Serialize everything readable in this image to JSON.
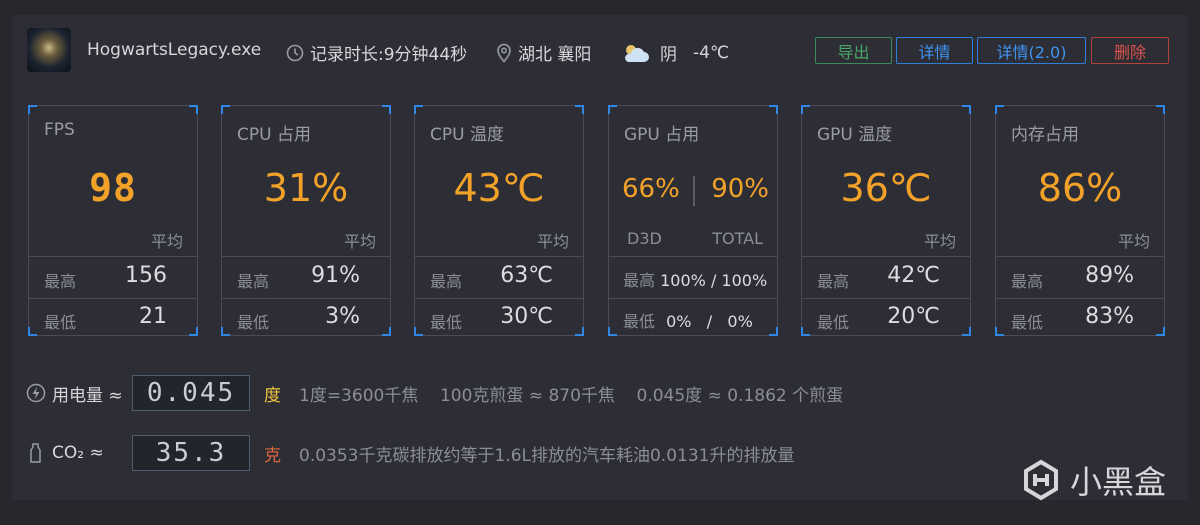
{
  "header": {
    "app_name": "HogwartsLegacy.exe",
    "record_duration": "记录时长:9分钟44秒",
    "location": "湖北 襄阳",
    "weather": "阴",
    "temperature": "-4℃",
    "buttons": {
      "export": "导出",
      "detail": "详情",
      "detail2": "详情(2.0)",
      "delete": "删除"
    }
  },
  "cards": {
    "fps": {
      "title": "FPS",
      "value": "98",
      "avg": "平均",
      "max_label": "最高",
      "max": "156",
      "min_label": "最低",
      "min": "21"
    },
    "cpu_usage": {
      "title": "CPU 占用",
      "value": "31%",
      "avg": "平均",
      "max_label": "最高",
      "max": "91%",
      "min_label": "最低",
      "min": "3%"
    },
    "cpu_temp": {
      "title": "CPU 温度",
      "value": "43℃",
      "avg": "平均",
      "max_label": "最高",
      "max": "63℃",
      "min_label": "最低",
      "min": "30℃"
    },
    "gpu_usage": {
      "title": "GPU 占用",
      "d3d": "66%",
      "total": "90%",
      "d3d_label": "D3D",
      "total_label": "TOTAL",
      "max_label": "最高",
      "max": "100% / 100%",
      "min_label": "最低",
      "min": "0%   /   0%"
    },
    "gpu_temp": {
      "title": "GPU 温度",
      "value": "36℃",
      "avg": "平均",
      "max_label": "最高",
      "max": "42℃",
      "min_label": "最低",
      "min": "20℃"
    },
    "memory": {
      "title": "内存占用",
      "value": "86%",
      "avg": "平均",
      "max_label": "最高",
      "max": "89%",
      "min_label": "最低",
      "min": "83%"
    }
  },
  "power": {
    "label": "用电量 ≈",
    "value": "0.045",
    "unit": "度",
    "note": "1度=3600千焦    100克煎蛋 ≈ 870千焦    0.045度 ≈ 0.1862 个煎蛋"
  },
  "co2": {
    "label": "CO₂ ≈",
    "value": "35.3",
    "unit": "克",
    "note": "0.0353千克碳排放约等于1.6L排放的汽车耗油0.0131升的排放量"
  },
  "watermark": {
    "text": "小黑盒"
  },
  "colors": {
    "accent": "#f2a229",
    "blue": "#3f93f0",
    "green": "#49a868",
    "red": "#d9524d"
  }
}
